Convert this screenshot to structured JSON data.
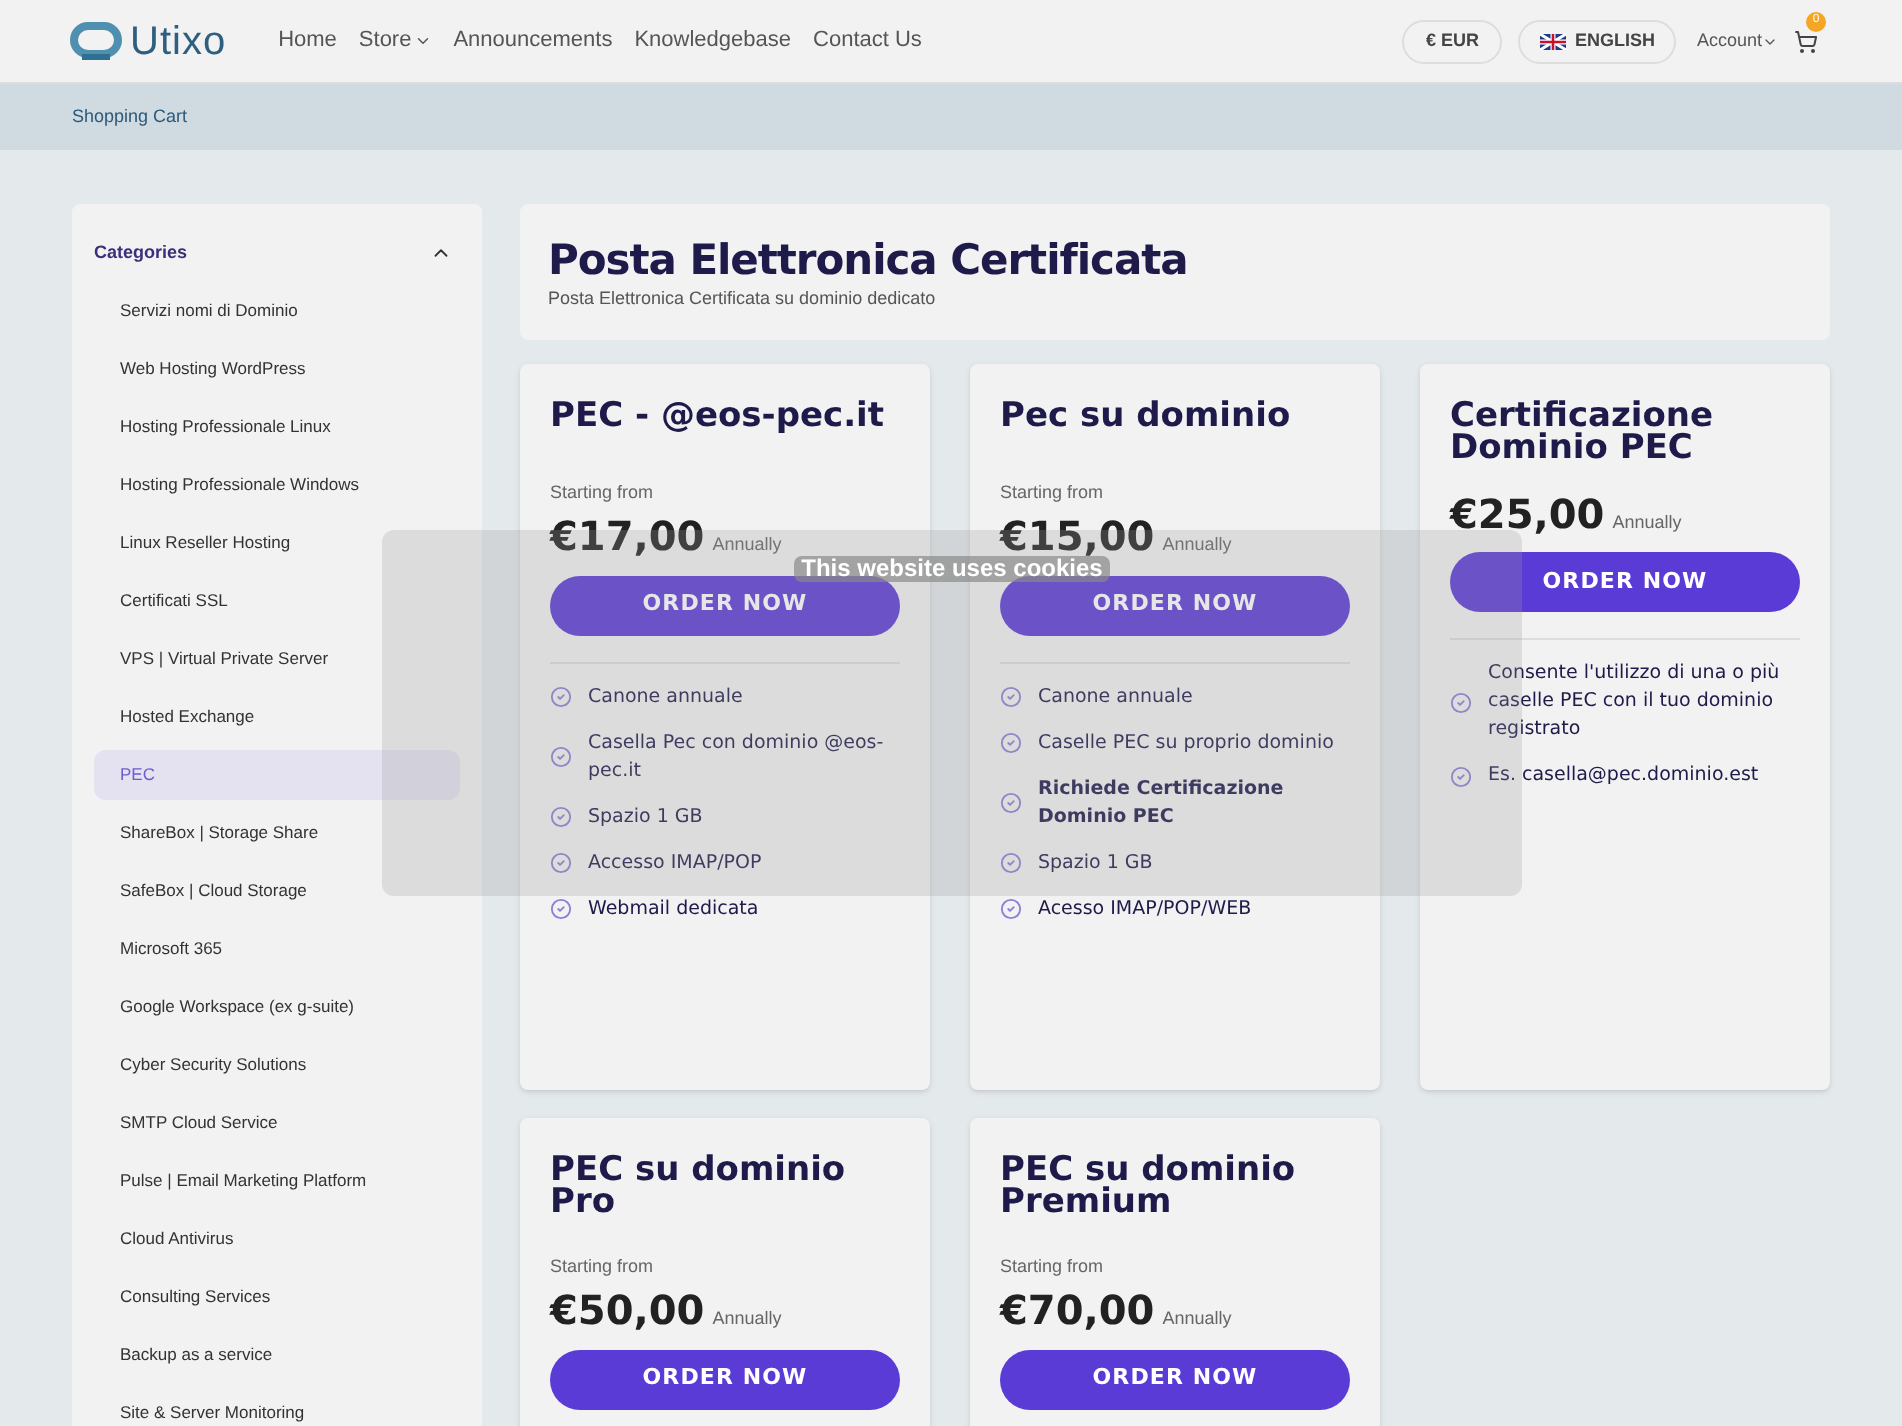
{
  "header": {
    "logo": "Utixo",
    "nav": [
      {
        "label": "Home",
        "dropdown": false
      },
      {
        "label": "Store",
        "dropdown": true
      },
      {
        "label": "Announcements",
        "dropdown": false
      },
      {
        "label": "Knowledgebase",
        "dropdown": false
      },
      {
        "label": "Contact Us",
        "dropdown": false
      }
    ],
    "currency": "€ EUR",
    "language": "ENGLISH",
    "account": "Account",
    "cart_count": "0"
  },
  "breadcrumb": "Shopping Cart",
  "sidebar": {
    "title": "Categories",
    "expanded": true,
    "items": [
      {
        "label": "Servizi nomi di Dominio",
        "selected": false
      },
      {
        "label": "Web Hosting WordPress",
        "selected": false
      },
      {
        "label": "Hosting Professionale Linux",
        "selected": false
      },
      {
        "label": "Hosting Professionale Windows",
        "selected": false
      },
      {
        "label": "Linux Reseller Hosting",
        "selected": false
      },
      {
        "label": "Certificati SSL",
        "selected": false
      },
      {
        "label": "VPS | Virtual Private Server",
        "selected": false
      },
      {
        "label": "Hosted Exchange",
        "selected": false
      },
      {
        "label": "PEC",
        "selected": true
      },
      {
        "label": "ShareBox | Storage Share",
        "selected": false
      },
      {
        "label": "SafeBox | Cloud Storage",
        "selected": false
      },
      {
        "label": "Microsoft 365",
        "selected": false
      },
      {
        "label": "Google Workspace (ex g-suite)",
        "selected": false
      },
      {
        "label": "Cyber Security Solutions",
        "selected": false
      },
      {
        "label": "SMTP Cloud Service",
        "selected": false
      },
      {
        "label": "Pulse | Email Marketing Platform",
        "selected": false
      },
      {
        "label": "Cloud Antivirus",
        "selected": false
      },
      {
        "label": "Consulting Services",
        "selected": false
      },
      {
        "label": "Backup as a service",
        "selected": false
      },
      {
        "label": "Site & Server Monitoring",
        "selected": false
      }
    ]
  },
  "page": {
    "title": "Posta Elettronica Certificata",
    "subtitle": "Posta Elettronica Certificata su dominio dedicato"
  },
  "products": [
    {
      "name": "PEC - @eos-pec.it",
      "starting_from": "Starting from",
      "price": "€17,00",
      "cycle": "Annually",
      "button": "ORDER NOW",
      "features": [
        {
          "text": "Canone annuale",
          "bold": false
        },
        {
          "text": "Casella Pec con dominio @eos-pec.it",
          "bold": false
        },
        {
          "text": "Spazio 1 GB",
          "bold": false
        },
        {
          "text": "Accesso IMAP/POP",
          "bold": false
        },
        {
          "text": "Webmail dedicata",
          "bold": false
        }
      ]
    },
    {
      "name": "Pec su dominio",
      "starting_from": "Starting from",
      "price": "€15,00",
      "cycle": "Annually",
      "button": "ORDER NOW",
      "features": [
        {
          "text": "Canone annuale",
          "bold": false
        },
        {
          "text": "Caselle PEC su proprio dominio",
          "bold": false
        },
        {
          "text": "Richiede Certificazione Dominio PEC",
          "bold": true
        },
        {
          "text": "Spazio 1 GB",
          "bold": false
        },
        {
          "text": "Acesso IMAP/POP/WEB",
          "bold": false
        }
      ]
    },
    {
      "name": "Certificazione Dominio PEC",
      "price": "€25,00",
      "cycle": "Annually",
      "button": "ORDER NOW",
      "features": [
        {
          "text": "Consente l'utilizzo di una o più caselle PEC con il tuo dominio registrato",
          "bold": false
        },
        {
          "text": "Es. casella@pec.dominio.est",
          "bold": false
        }
      ]
    },
    {
      "name": "PEC su dominio Pro",
      "starting_from": "Starting from",
      "price": "€50,00",
      "cycle": "Annually",
      "button": "ORDER NOW"
    },
    {
      "name": "PEC su dominio Premium",
      "starting_from": "Starting from",
      "price": "€70,00",
      "cycle": "Annually",
      "button": "ORDER NOW"
    }
  ],
  "cookie_banner": {
    "title": "This website uses cookies"
  }
}
